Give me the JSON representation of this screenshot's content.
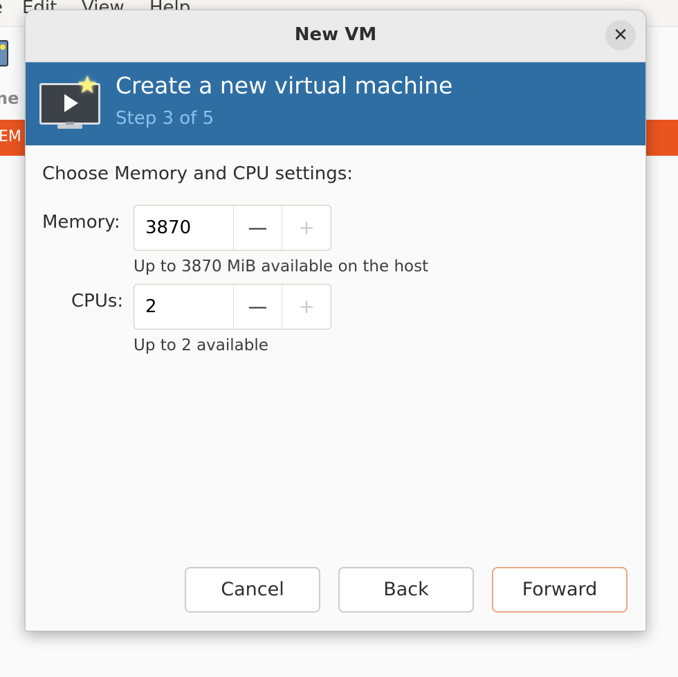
{
  "background": {
    "menu": [
      "e",
      "Edit",
      "View",
      "Help"
    ],
    "column_header": "ne",
    "selected_row_text": "EM"
  },
  "dialog": {
    "title": "New VM",
    "close_glyph": "✕"
  },
  "banner": {
    "title": "Create a new virtual machine",
    "step": "Step 3 of 5"
  },
  "form": {
    "section_label": "Choose Memory and CPU settings:",
    "memory": {
      "label": "Memory:",
      "value": "3870",
      "decrement": "—",
      "increment": "+",
      "hint": "Up to 3870 MiB available on the host"
    },
    "cpus": {
      "label": "CPUs:",
      "value": "2",
      "decrement": "—",
      "increment": "+",
      "hint": "Up to 2 available"
    }
  },
  "buttons": {
    "cancel": "Cancel",
    "back": "Back",
    "forward": "Forward"
  },
  "colors": {
    "banner_bg": "#2f6ea3",
    "step_text": "#8cc0ea",
    "selection_orange": "#e95420",
    "primary_border": "#e8a884"
  }
}
